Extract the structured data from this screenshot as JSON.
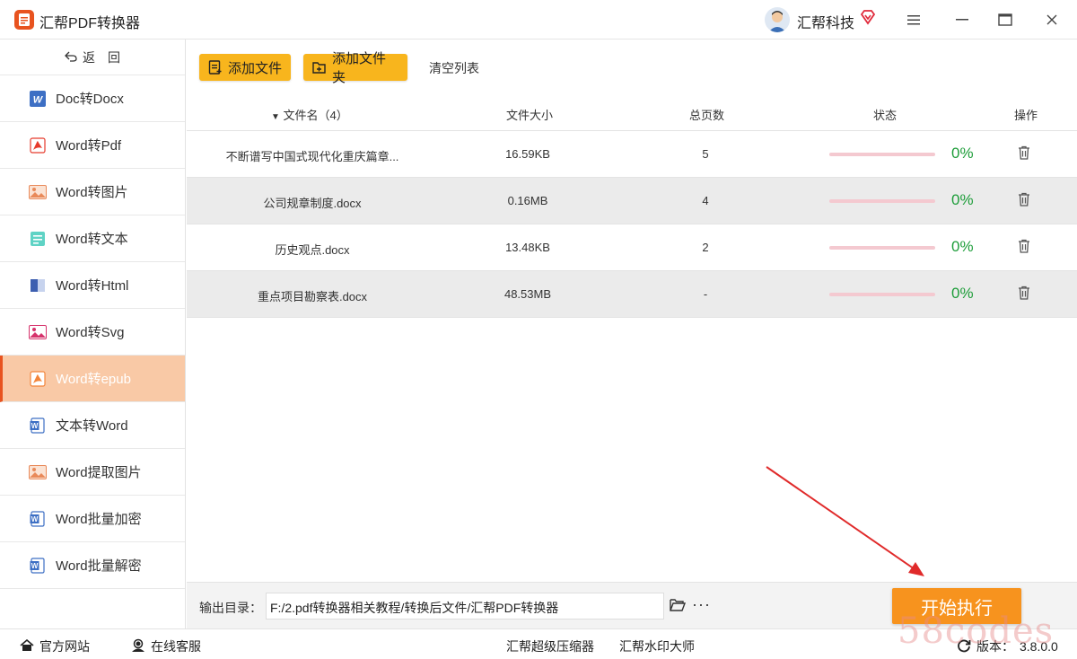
{
  "app": {
    "title": "汇帮PDF转换器",
    "user_name": "汇帮科技"
  },
  "sidebar": {
    "back_label": "返　回",
    "items": [
      {
        "label": "Doc转Docx",
        "icon": "word-icon"
      },
      {
        "label": "Word转Pdf",
        "icon": "pdf-icon"
      },
      {
        "label": "Word转图片",
        "icon": "image-icon"
      },
      {
        "label": "Word转文本",
        "icon": "text-icon"
      },
      {
        "label": "Word转Html",
        "icon": "html-icon"
      },
      {
        "label": "Word转Svg",
        "icon": "svg-icon"
      },
      {
        "label": "Word转epub",
        "icon": "epub-icon",
        "active": true
      },
      {
        "label": "文本转Word",
        "icon": "word-doc-icon"
      },
      {
        "label": "Word提取图片",
        "icon": "image-icon"
      },
      {
        "label": "Word批量加密",
        "icon": "word-doc-icon"
      },
      {
        "label": "Word批量解密",
        "icon": "word-doc-icon"
      }
    ]
  },
  "toolbar": {
    "add_file": "添加文件",
    "add_folder": "添加文件夹",
    "clear_list": "清空列表"
  },
  "table": {
    "headers": {
      "name": "文件名（4）",
      "size": "文件大小",
      "pages": "总页数",
      "status": "状态",
      "action": "操作"
    },
    "rows": [
      {
        "name": "不断谱写中国式现代化重庆篇章...",
        "size": "16.59KB",
        "pages": "5",
        "progress": 0,
        "percent": "0%"
      },
      {
        "name": "公司规章制度.docx",
        "size": "0.16MB",
        "pages": "4",
        "progress": 0,
        "percent": "0%"
      },
      {
        "name": "历史观点.docx",
        "size": "13.48KB",
        "pages": "2",
        "progress": 0,
        "percent": "0%"
      },
      {
        "name": "重点项目勘察表.docx",
        "size": "48.53MB",
        "pages": "-",
        "progress": 0,
        "percent": "0%"
      }
    ]
  },
  "output": {
    "label": "输出目录：",
    "path": "F:/2.pdf转换器相关教程/转换后文件/汇帮PDF转换器",
    "more": "···",
    "start_label": "开始执行"
  },
  "footer": {
    "site": "官方网站",
    "service": "在线客服",
    "compress": "汇帮超级压缩器",
    "watermark": "汇帮水印大师",
    "version_label": "版本：",
    "version": "3.8.0.0"
  },
  "overlay_watermark": "58codes",
  "colors": {
    "accent": "#e8531f",
    "button_yellow": "#f8b51d",
    "start_orange": "#f7931e",
    "progress_bg": "#f4c9d0",
    "percent_green": "#1e9d3a",
    "active_item_bg": "#f9c9a6"
  }
}
